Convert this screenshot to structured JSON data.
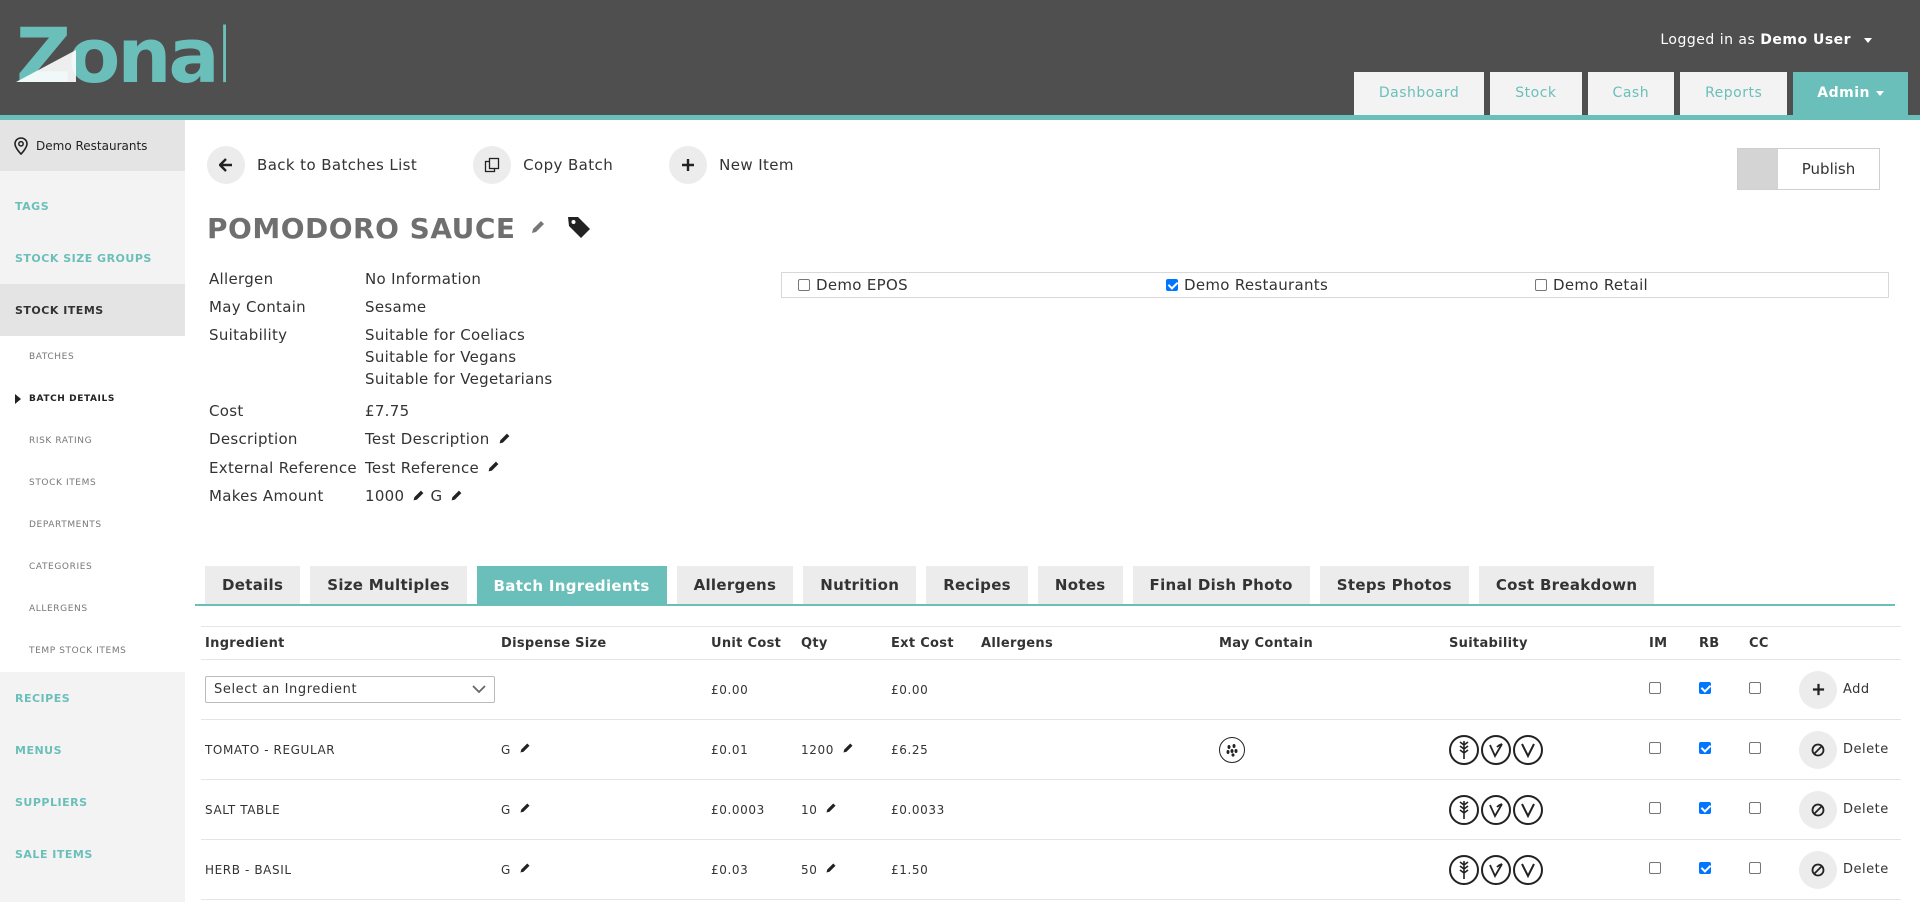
{
  "header": {
    "logo": "Zonal",
    "user_prefix": "Logged in as",
    "user_name": "Demo User",
    "nav": [
      "Dashboard",
      "Stock",
      "Cash",
      "Reports"
    ],
    "nav_active": "Admin"
  },
  "sidebar": {
    "site": "Demo Restaurants",
    "items_top": [
      "TAGS",
      "STOCK SIZE GROUPS"
    ],
    "active_item": "STOCK ITEMS",
    "sub_items": [
      "BATCHES",
      "BATCH DETAILS",
      "RISK RATING",
      "STOCK ITEMS",
      "DEPARTMENTS",
      "CATEGORIES",
      "ALLERGENS",
      "TEMP STOCK ITEMS"
    ],
    "items_bottom": [
      "RECIPES",
      "MENUS",
      "SUPPLIERS",
      "SALE ITEMS"
    ]
  },
  "actions": {
    "back": "Back to Batches List",
    "copy": "Copy Batch",
    "new": "New Item",
    "publish": "Publish"
  },
  "title": "POMODORO SAUCE",
  "props": {
    "allergen_k": "Allergen",
    "allergen_v": "No Information",
    "may_contain_k": "May Contain",
    "may_contain_v": "Sesame",
    "suitability_k": "Suitability",
    "suitability_v": [
      "Suitable for Coeliacs",
      "Suitable for Vegans",
      "Suitable for Vegetarians"
    ],
    "cost_k": "Cost",
    "cost_v": "£7.75",
    "description_k": "Description",
    "description_v": "Test Description",
    "ext_ref_k": "External Reference",
    "ext_ref_v": "Test Reference",
    "makes_k": "Makes Amount",
    "makes_v": "1000",
    "makes_unit": "G"
  },
  "sites": [
    {
      "label": "Demo EPOS",
      "checked": false
    },
    {
      "label": "Demo Restaurants",
      "checked": true
    },
    {
      "label": "Demo Retail",
      "checked": false
    }
  ],
  "tabs": [
    "Details",
    "Size Multiples",
    "Batch Ingredients",
    "Allergens",
    "Nutrition",
    "Recipes",
    "Notes",
    "Final Dish Photo",
    "Steps Photos",
    "Cost Breakdown"
  ],
  "tab_active": "Batch Ingredients",
  "table": {
    "headers": [
      "Ingredient",
      "Dispense Size",
      "Unit Cost",
      "Qty",
      "Ext Cost",
      "Allergens",
      "May Contain",
      "Suitability",
      "IM",
      "RB",
      "CC"
    ],
    "new_row": {
      "placeholder": "Select an Ingredient",
      "unit_cost": "£0.00",
      "ext_cost": "£0.00",
      "action": "Add"
    },
    "rows": [
      {
        "ingredient": "TOMATO - REGULAR",
        "size": "G",
        "unit_cost": "£0.01",
        "qty": "1200",
        "ext_cost": "£6.25",
        "action": "Delete"
      },
      {
        "ingredient": "SALT TABLE",
        "size": "G",
        "unit_cost": "£0.0003",
        "qty": "10",
        "ext_cost": "£0.0033",
        "action": "Delete"
      },
      {
        "ingredient": "HERB - BASIL",
        "size": "G",
        "unit_cost": "£0.03",
        "qty": "50",
        "ext_cost": "£1.50",
        "action": "Delete"
      }
    ]
  },
  "colors": {
    "accent": "#6bbfba",
    "header": "#4f4f4f"
  }
}
